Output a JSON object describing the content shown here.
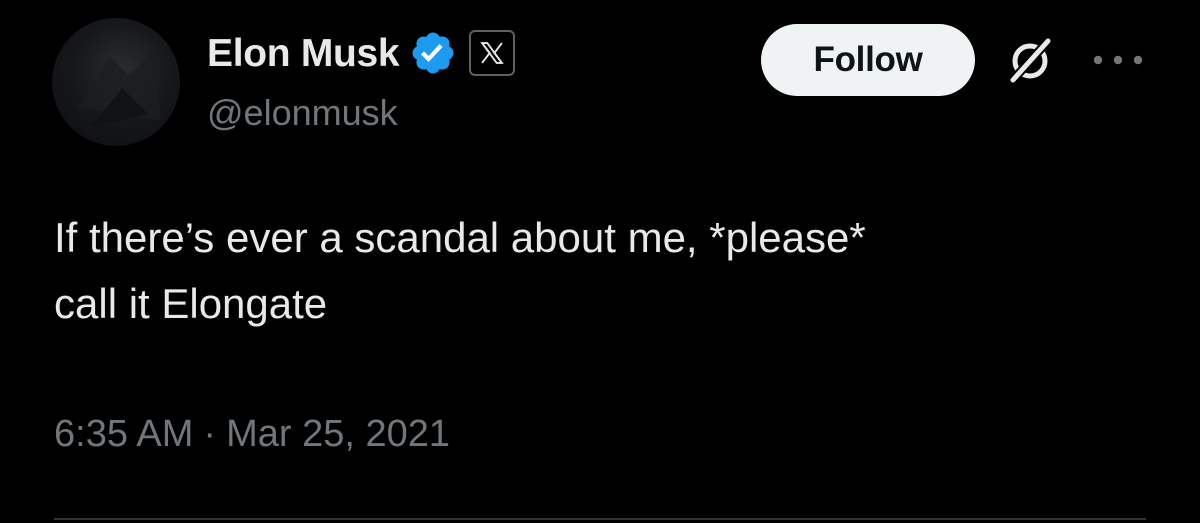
{
  "tweet": {
    "author": {
      "display_name": "Elon Musk",
      "handle": "@elonmusk",
      "verified": true,
      "affiliate_badge": "x-logo"
    },
    "follow_label": "Follow",
    "text": "If there’s ever a scandal about me, *please*\ncall it Elongate",
    "time": "6:35 AM",
    "separator": "·",
    "date": "Mar 25, 2021"
  },
  "colors": {
    "background": "#000000",
    "primary_text": "#e7e9ea",
    "secondary_text": "#71767b",
    "verified_blue": "#1d9bf0",
    "follow_button_bg": "#eff3f4",
    "follow_button_text": "#0f1419"
  },
  "icons": [
    "verified-badge-icon",
    "x-logo-icon",
    "grok-icon",
    "more-icon"
  ]
}
